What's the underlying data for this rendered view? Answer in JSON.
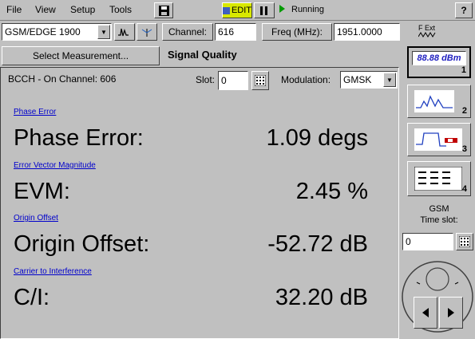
{
  "menu": {
    "file": "File",
    "view": "View",
    "setup": "Setup",
    "tools": "Tools",
    "edit_label": "EDIT",
    "status": "Running",
    "help": "?"
  },
  "toolbar": {
    "standard": "GSM/EDGE 1900",
    "channel_label": "Channel:",
    "channel_value": "616",
    "freq_label": "Freq (MHz):",
    "freq_value": "1951.0000",
    "f_ext": "F Ext",
    "select_measurement": "Select Measurement...",
    "measurement_title": "Signal Quality"
  },
  "main": {
    "bcch": "BCCH - On Channel: 606",
    "slot_label": "Slot:",
    "slot_value": "0",
    "modulation_label": "Modulation:",
    "modulation_value": "GMSK",
    "phase_error_link": "Phase Error",
    "phase_error_label": "Phase Error:",
    "phase_error_value": "1.09 degs",
    "evm_link": "Error Vector Magnitude",
    "evm_label": "EVM:",
    "evm_value": "2.45 %",
    "origin_link": "Origin Offset",
    "origin_label": "Origin Offset:",
    "origin_value": "-52.72 dB",
    "ci_link": "Carrier to Interference",
    "ci_label": "C/I:",
    "ci_value": "32.20 dB"
  },
  "side": {
    "dbm_display": "88.88 dBm",
    "btn1_num": "1",
    "btn2_num": "2",
    "btn3_num": "3",
    "btn4_num": "4",
    "gsm_label": "GSM",
    "timeslot_label": "Time slot:",
    "timeslot_value": "0"
  }
}
